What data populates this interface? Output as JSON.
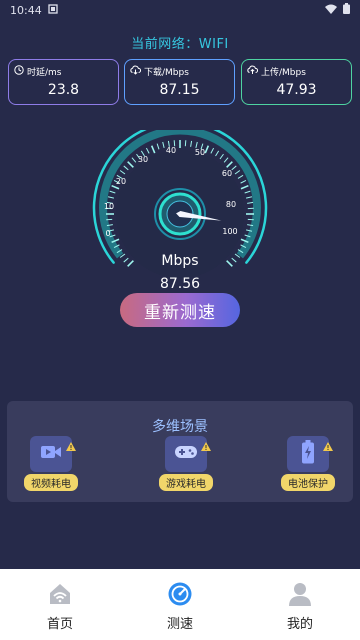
{
  "status_bar": {
    "time": "10:44"
  },
  "network": {
    "label": "当前网络：WIFI"
  },
  "metrics": {
    "latency": {
      "label": "时延/ms",
      "value": "23.8",
      "icon": "clock-icon",
      "color": "#8e7ce8"
    },
    "download": {
      "label": "下载/Mbps",
      "value": "87.15",
      "icon": "cloud-download-icon",
      "color": "#5fa0ff"
    },
    "upload": {
      "label": "上传/Mbps",
      "value": "47.93",
      "icon": "cloud-upload-icon",
      "color": "#4ed3a1"
    }
  },
  "gauge": {
    "ticks": [
      "0",
      "10",
      "20",
      "30",
      "40",
      "50",
      "60",
      "80",
      "100"
    ],
    "unit": "Mbps",
    "value_text": "87.56",
    "needle_value": 87.56,
    "accent": "#2ee0d0"
  },
  "retest_button": {
    "label": "重新测速"
  },
  "scenes": {
    "title": "多维场景",
    "items": [
      {
        "label": "视频耗电",
        "icon": "video-icon"
      },
      {
        "label": "游戏耗电",
        "icon": "gamepad-icon"
      },
      {
        "label": "电池保护",
        "icon": "battery-icon"
      }
    ]
  },
  "bottom_nav": {
    "items": [
      {
        "label": "首页",
        "icon": "home-wifi-icon",
        "active": false
      },
      {
        "label": "测速",
        "icon": "speedometer-icon",
        "active": true
      },
      {
        "label": "我的",
        "icon": "user-icon",
        "active": false
      }
    ],
    "active_color": "#2c8cf0",
    "inactive_color": "#b9bcc4"
  }
}
